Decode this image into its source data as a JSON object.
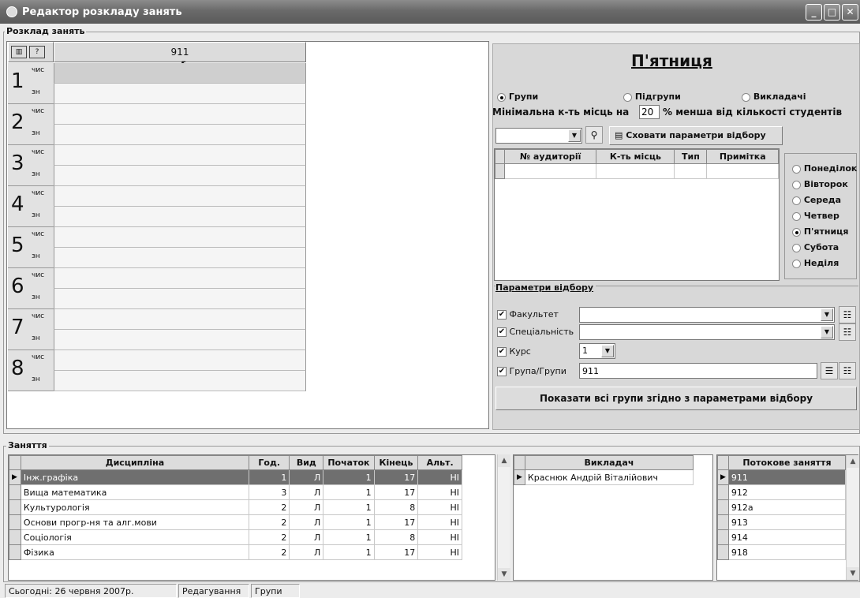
{
  "window": {
    "title": "Редактор розкладу занять"
  },
  "schedule": {
    "group_label": "Розклад занять",
    "column_header": "911",
    "periods": [
      {
        "num": "1",
        "top": "чис",
        "bottom": "зн"
      },
      {
        "num": "2",
        "top": "чис",
        "bottom": "зн"
      },
      {
        "num": "3",
        "top": "чис",
        "bottom": "зн"
      },
      {
        "num": "4",
        "top": "чис",
        "bottom": "зн"
      },
      {
        "num": "5",
        "top": "чис",
        "bottom": "зн"
      },
      {
        "num": "6",
        "top": "чис",
        "bottom": "зн"
      },
      {
        "num": "7",
        "top": "чис",
        "bottom": "зн"
      },
      {
        "num": "8",
        "top": "чис",
        "bottom": "зн"
      }
    ]
  },
  "rooms": {
    "day_title": "П'ятниця",
    "radio": {
      "groups": "Групи",
      "subgroups": "Підгрупи",
      "teachers": "Викладачі",
      "selected": "Групи"
    },
    "min_seats": {
      "label": "Мінімальна к-ть місць  на",
      "value": "20",
      "suffix": "% менша від кількості студентів"
    },
    "hide_button": "Сховати параметри відбору",
    "columns": [
      "№ аудиторії",
      "К-ть місць",
      "Тип",
      "Примітка"
    ],
    "days": [
      "Понеділок",
      "Вівторок",
      "Середа",
      "Четвер",
      "П'ятниця",
      "Субота",
      "Неділя"
    ],
    "selected_day": "П'ятниця"
  },
  "filter": {
    "label": "Параметри відбору",
    "faculty_label": "Факультет",
    "faculty_value": "",
    "specialty_label": "Спеціальність",
    "specialty_value": "",
    "course_label": "Курс",
    "course_value": "1",
    "group_label": "Група/Групи",
    "group_value": "911",
    "show_button": "Показати всі групи згідно з параметрами відбору"
  },
  "lessons": {
    "label": "Заняття",
    "columns": [
      "Дисципліна",
      "Год.",
      "Вид",
      "Початок",
      "Кінець",
      "Альт."
    ],
    "rows": [
      [
        "Інж.графіка",
        "1",
        "Л",
        "1",
        "17",
        "НІ"
      ],
      [
        "Вища математика",
        "3",
        "Л",
        "1",
        "17",
        "НІ"
      ],
      [
        "Культурологія",
        "2",
        "Л",
        "1",
        "8",
        "НІ"
      ],
      [
        "Основи прогр-ня та алг.мови",
        "2",
        "Л",
        "1",
        "17",
        "НІ"
      ],
      [
        "Соціологія",
        "2",
        "Л",
        "1",
        "8",
        "НІ"
      ],
      [
        "Фізика",
        "2",
        "Л",
        "1",
        "17",
        "НІ"
      ]
    ],
    "teacher_header": "Викладач",
    "teachers": [
      "Краснюк Андрій Віталійович"
    ],
    "stream_header": "Потокове заняття",
    "streams": [
      "911",
      "912",
      "912а",
      "913",
      "914",
      "918"
    ]
  },
  "status": {
    "date": "Сьогодні: 26 червня 2007р.",
    "mode": "Редагування",
    "view": "Групи"
  }
}
